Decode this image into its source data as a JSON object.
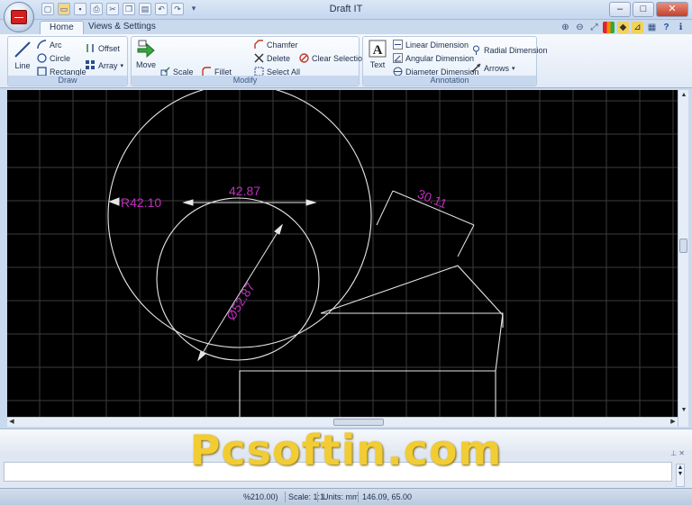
{
  "window": {
    "title": "Draft IT",
    "minimize": "–",
    "maximize": "□",
    "close": "✕"
  },
  "quick_access": [
    "new-icon",
    "open-icon",
    "save-icon",
    "print-icon",
    "cut-icon",
    "copy-icon",
    "paste-icon",
    "undo-icon",
    "redo-icon"
  ],
  "tabs": [
    {
      "label": "Home",
      "active": true
    },
    {
      "label": "Views & Settings",
      "active": false
    }
  ],
  "ribbon": {
    "draw": {
      "label": "Draw",
      "line": "Line",
      "arc": "Arc",
      "circle": "Circle",
      "rectangle": "Rectangle",
      "offset": "Offset",
      "array": "Array"
    },
    "modify": {
      "label": "Modify",
      "move": "Move",
      "scale": "Scale",
      "fillet": "Fillet",
      "chamfer": "Chamfer",
      "delete": "Delete",
      "select_all": "Select All",
      "clear_selection": "Clear Selection"
    },
    "annotation": {
      "label": "Annotation",
      "text": "Text",
      "linear": "Linear Dimension",
      "angular": "Angular Dimension",
      "diameter": "Diameter Dimension",
      "radial": "Radial Dimension",
      "arrows": "Arrows"
    }
  },
  "drawing": {
    "dim_radius": "R42.10",
    "dim_linear_top": "42.87",
    "dim_angle": "30.11",
    "dim_diameter": "Ø52.87",
    "colors": {
      "background": "#000000",
      "grid": "#3b3b3b",
      "geometry": "#e6e6e6",
      "dimension_text": "#c02ec0"
    }
  },
  "watermark": "Pcsoftin.com",
  "status": {
    "coords_left": "%210.00)",
    "scale": "Scale: 1:1",
    "units": "Units: mm",
    "cursor": "146.09, 65.00"
  }
}
